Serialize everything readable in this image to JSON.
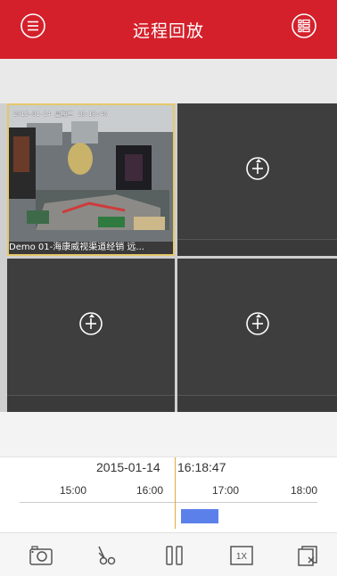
{
  "header": {
    "title": "远程回放",
    "menu_icon": "menu-icon",
    "list_icon": "list-view-icon",
    "background": "#d4202b"
  },
  "panes": [
    {
      "label": "Demo 01-海康威视渠道经销 远...",
      "osd": "2015-01-14 星期三 16:18:46",
      "has_video": true
    },
    {
      "add_icon": "add-camera-icon",
      "has_video": false
    },
    {
      "add_icon": "add-camera-icon",
      "has_video": false
    },
    {
      "add_icon": "add-camera-icon",
      "has_video": false
    }
  ],
  "timeline": {
    "date": "2015-01-14",
    "time": "16:18:47",
    "ticks": [
      "15:00",
      "16:00",
      "17:00",
      "18:00"
    ],
    "cursor_color": "#e4a93a",
    "recording_color": "#5c80ea"
  },
  "toolbar": {
    "snapshot_icon": "camera-icon",
    "clip_icon": "scissors-icon",
    "pause_icon": "pause-icon",
    "speed_label": "1X",
    "close_all_icon": "close-window-icon"
  }
}
